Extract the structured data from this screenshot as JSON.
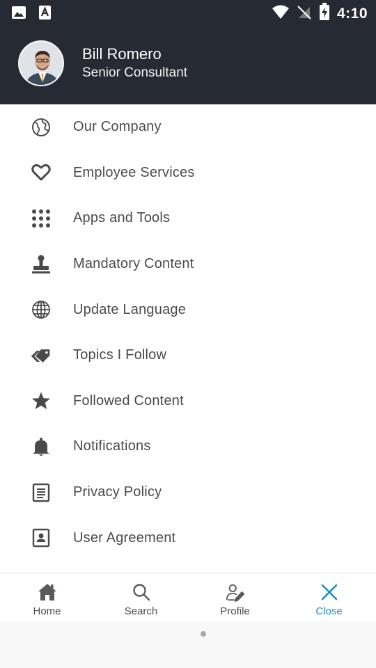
{
  "status_bar": {
    "time": "4:10",
    "icons": [
      "image-icon",
      "font-icon",
      "wifi-icon",
      "no-signal-icon",
      "battery-charging-icon"
    ]
  },
  "profile": {
    "name": "Bill Romero",
    "role": "Senior Consultant"
  },
  "menu": {
    "items": [
      {
        "label": "Our Company",
        "icon": "globe-outline-icon"
      },
      {
        "label": "Employee Services",
        "icon": "heart-icon"
      },
      {
        "label": "Apps and Tools",
        "icon": "grid-dots-icon"
      },
      {
        "label": "Mandatory Content",
        "icon": "stamp-icon"
      },
      {
        "label": "Update Language",
        "icon": "globe-grid-icon"
      },
      {
        "label": "Topics I Follow",
        "icon": "tags-icon"
      },
      {
        "label": "Followed Content",
        "icon": "star-icon"
      },
      {
        "label": "Notifications",
        "icon": "bell-icon"
      },
      {
        "label": "Privacy Policy",
        "icon": "document-icon"
      },
      {
        "label": "User Agreement",
        "icon": "contact-card-icon"
      }
    ]
  },
  "bottom_nav": {
    "items": [
      {
        "label": "Home",
        "icon": "home-icon"
      },
      {
        "label": "Search",
        "icon": "search-icon"
      },
      {
        "label": "Profile",
        "icon": "profile-edit-icon"
      },
      {
        "label": "Close",
        "icon": "close-icon",
        "active": true
      }
    ]
  },
  "colors": {
    "header_bg": "#262a33",
    "accent": "#1a8fbf",
    "menu_text": "#4b4b4b",
    "icon": "#4a4a4a"
  }
}
